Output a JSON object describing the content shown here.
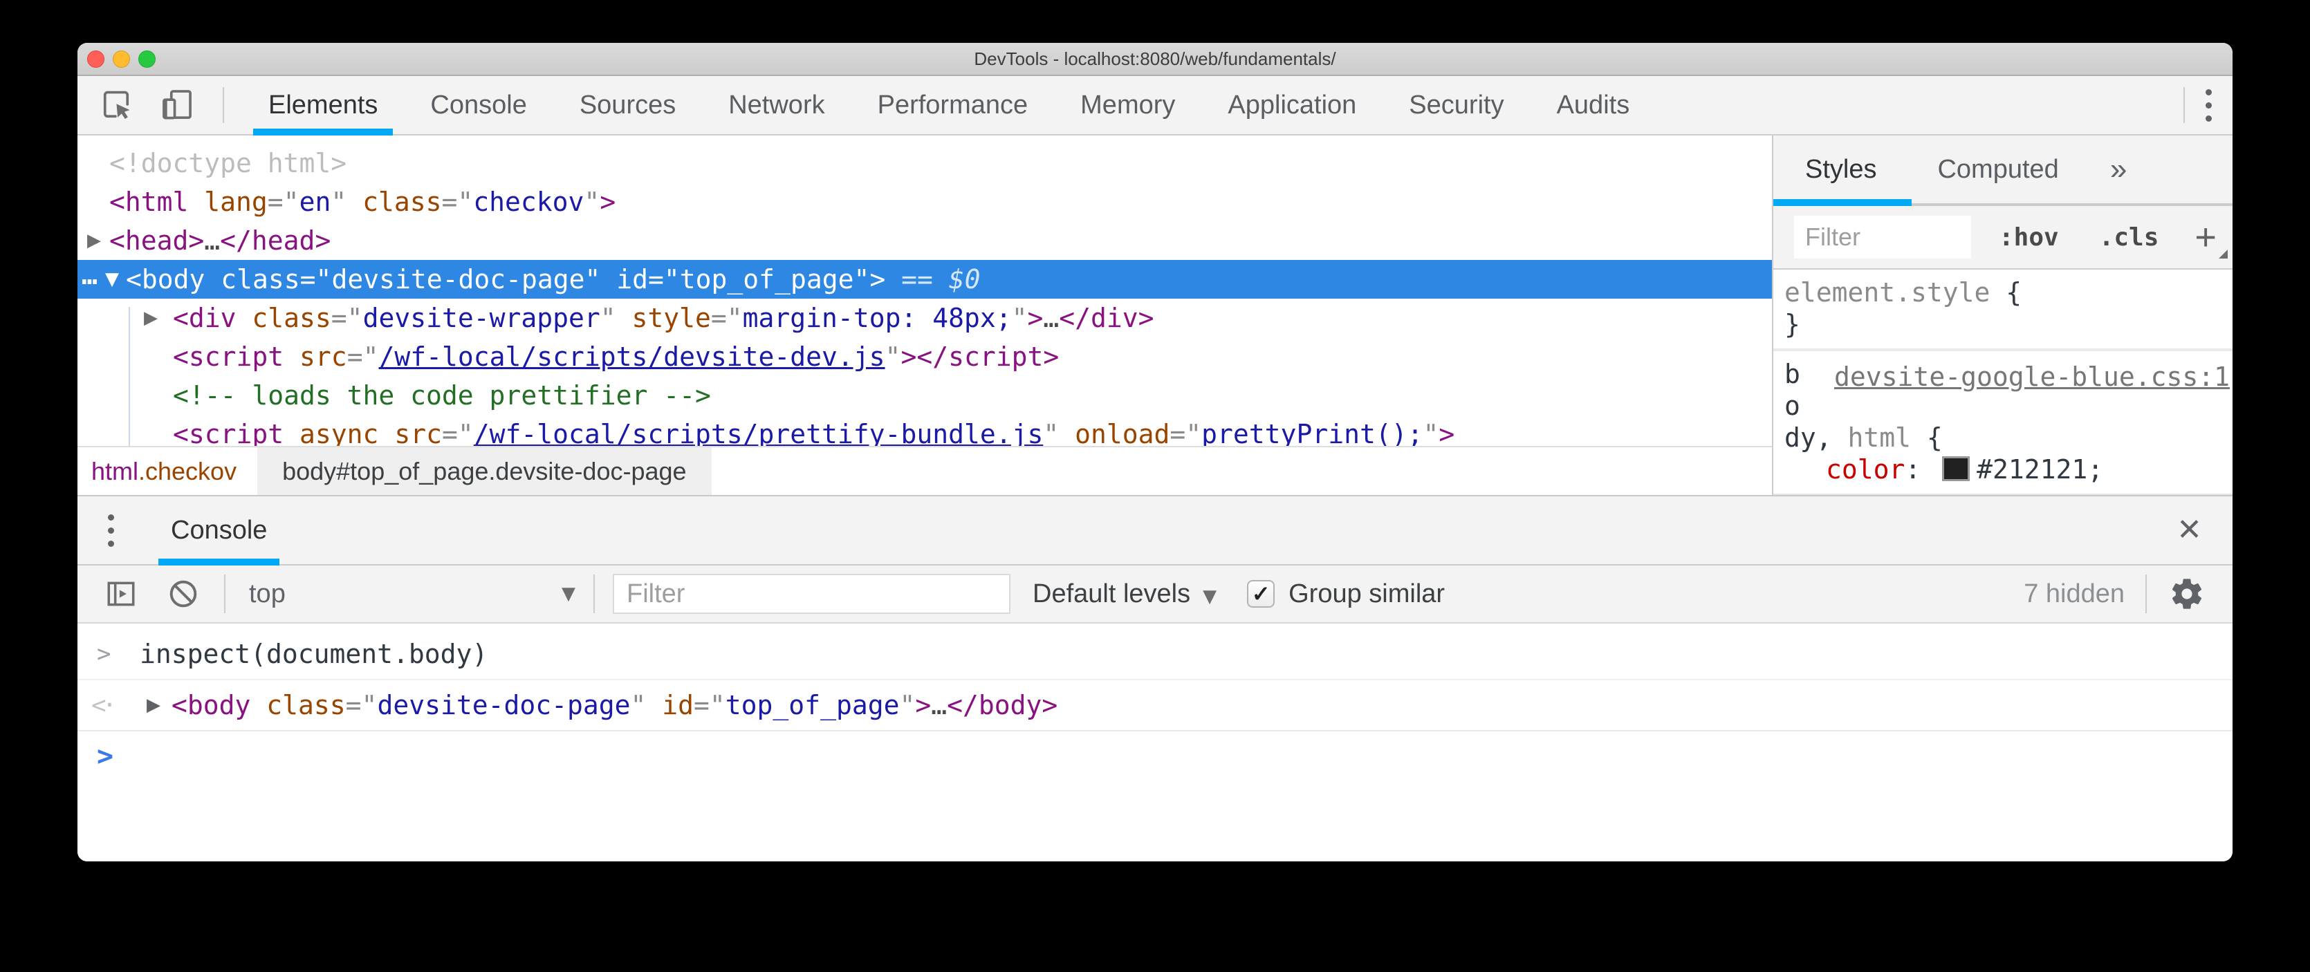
{
  "window": {
    "title": "DevTools - localhost:8080/web/fundamentals/"
  },
  "colors": {
    "accent": "#03a9f4",
    "selection": "#2e87e2",
    "tag": "#881280",
    "attr": "#994500",
    "value": "#1a1aa6",
    "comment": "#236e25",
    "property": "#c80000",
    "swatch": "#212121"
  },
  "main_tabs": {
    "items": [
      {
        "label": "Elements",
        "active": true
      },
      {
        "label": "Console",
        "active": false
      },
      {
        "label": "Sources",
        "active": false
      },
      {
        "label": "Network",
        "active": false
      },
      {
        "label": "Performance",
        "active": false
      },
      {
        "label": "Memory",
        "active": false
      },
      {
        "label": "Application",
        "active": false
      },
      {
        "label": "Security",
        "active": false
      },
      {
        "label": "Audits",
        "active": false
      }
    ]
  },
  "elements_panel": {
    "rows": [
      {
        "indent": 0,
        "tokens": [
          [
            "doctype",
            "<!doctype html>"
          ]
        ]
      },
      {
        "indent": 0,
        "tokens": [
          [
            "tag",
            "<html"
          ],
          [
            "plain",
            " "
          ],
          [
            "attr",
            "lang"
          ],
          [
            "p",
            "=\""
          ],
          [
            "val",
            "en"
          ],
          [
            "p",
            "\""
          ],
          [
            "plain",
            " "
          ],
          [
            "attr",
            "class"
          ],
          [
            "p",
            "=\""
          ],
          [
            "val",
            "checkov"
          ],
          [
            "p",
            "\""
          ],
          [
            "tag",
            ">"
          ]
        ]
      },
      {
        "indent": 0,
        "arrow": "closed",
        "tokens": [
          [
            "tag",
            "<head"
          ],
          [
            "tag",
            ">"
          ],
          [
            "dots",
            "…"
          ],
          [
            "tag",
            "</head>"
          ]
        ]
      },
      {
        "indent": 0,
        "arrow": "open",
        "dots_menu": true,
        "selected": true,
        "tokens": [
          [
            "tag",
            "<body"
          ],
          [
            "plain",
            " "
          ],
          [
            "attr",
            "class"
          ],
          [
            "p",
            "=\""
          ],
          [
            "val",
            "devsite-doc-page"
          ],
          [
            "p",
            "\""
          ],
          [
            "plain",
            " "
          ],
          [
            "attr",
            "id"
          ],
          [
            "p",
            "=\""
          ],
          [
            "val",
            "top_of_page"
          ],
          [
            "p",
            "\""
          ],
          [
            "tag",
            ">"
          ],
          [
            "eq",
            " == $0"
          ]
        ]
      },
      {
        "indent": 1,
        "arrow": "closed",
        "tokens": [
          [
            "tag",
            "<div"
          ],
          [
            "plain",
            " "
          ],
          [
            "attr",
            "class"
          ],
          [
            "p",
            "=\""
          ],
          [
            "val",
            "devsite-wrapper"
          ],
          [
            "p",
            "\""
          ],
          [
            "plain",
            " "
          ],
          [
            "attr",
            "style"
          ],
          [
            "p",
            "=\""
          ],
          [
            "val",
            "margin-top: 48px;"
          ],
          [
            "p",
            "\""
          ],
          [
            "tag",
            ">"
          ],
          [
            "dots",
            "…"
          ],
          [
            "tag",
            "</div>"
          ]
        ]
      },
      {
        "indent": 1,
        "tokens": [
          [
            "tag",
            "<script"
          ],
          [
            "plain",
            " "
          ],
          [
            "attr",
            "src"
          ],
          [
            "p",
            "=\""
          ],
          [
            "link",
            "/wf-local/scripts/devsite-dev.js"
          ],
          [
            "p",
            "\""
          ],
          [
            "tag",
            "></script>"
          ]
        ]
      },
      {
        "indent": 1,
        "tokens": [
          [
            "comment",
            "<!-- loads the code prettifier -->"
          ]
        ]
      },
      {
        "indent": 1,
        "tokens": [
          [
            "tag",
            "<script"
          ],
          [
            "plain",
            " "
          ],
          [
            "attr",
            "async"
          ],
          [
            "plain",
            " "
          ],
          [
            "attr",
            "src"
          ],
          [
            "p",
            "=\""
          ],
          [
            "link",
            "/wf-local/scripts/prettify-bundle.js"
          ],
          [
            "p",
            "\""
          ],
          [
            "plain",
            " "
          ],
          [
            "attr",
            "onload"
          ],
          [
            "p",
            "=\""
          ],
          [
            "val",
            "prettyPrint();"
          ],
          [
            "p",
            "\""
          ],
          [
            "tag",
            ">"
          ]
        ]
      }
    ]
  },
  "breadcrumbs": {
    "crumbs": [
      {
        "tokens": [
          [
            "tag",
            "html"
          ],
          [
            "attr",
            ".checkov"
          ]
        ]
      },
      {
        "text": "body#top_of_page.devsite-doc-page",
        "selected": true
      }
    ]
  },
  "styles_sidebar": {
    "tabs": [
      {
        "label": "Styles",
        "active": true
      },
      {
        "label": "Computed",
        "active": false
      }
    ],
    "overflow_icon": "»",
    "filter_placeholder": "Filter",
    "hov_label": ":hov",
    "cls_label": ".cls",
    "add_label": "+",
    "rules": [
      {
        "selector_lines": [
          [
            [
              "gray",
              "element.style"
            ],
            [
              "dark",
              " {"
            ]
          ]
        ],
        "close": [
          [
            "dark",
            "}"
          ]
        ]
      },
      {
        "link": "devsite-google-blue.css:1",
        "selector_lines": [
          [
            [
              "dark",
              "b"
            ]
          ],
          [
            [
              "dark",
              "o"
            ]
          ],
          [
            [
              "dark",
              "dy,"
            ],
            [
              "gray",
              " html"
            ],
            [
              "dark",
              " {"
            ]
          ]
        ],
        "props": [
          [
            [
              "prop",
              "color"
            ],
            [
              "dark",
              ": "
            ],
            [
              "swatch",
              ""
            ],
            [
              "dark",
              "#212121;"
            ]
          ]
        ]
      }
    ]
  },
  "drawer": {
    "tab_label": "Console"
  },
  "console": {
    "context_label": "top",
    "filter_placeholder": "Filter",
    "levels_label": "Default levels",
    "group_label": "Group similar",
    "group_checked": true,
    "check_glyph": "✓",
    "hidden_label": "7 hidden",
    "messages": [
      {
        "type": "command",
        "tokens": [
          [
            "cmd",
            "inspect(document.body)"
          ]
        ]
      },
      {
        "type": "result",
        "arrow": "closed",
        "tokens": [
          [
            "tag",
            "<body"
          ],
          [
            "plain",
            " "
          ],
          [
            "attr",
            "class"
          ],
          [
            "p",
            "=\""
          ],
          [
            "val",
            "devsite-doc-page"
          ],
          [
            "p",
            "\""
          ],
          [
            "plain",
            " "
          ],
          [
            "attr",
            "id"
          ],
          [
            "p",
            "=\""
          ],
          [
            "val",
            "top_of_page"
          ],
          [
            "p",
            "\""
          ],
          [
            "tag",
            ">"
          ],
          [
            "dots",
            "…"
          ],
          [
            "tag",
            "</body>"
          ]
        ]
      }
    ]
  }
}
